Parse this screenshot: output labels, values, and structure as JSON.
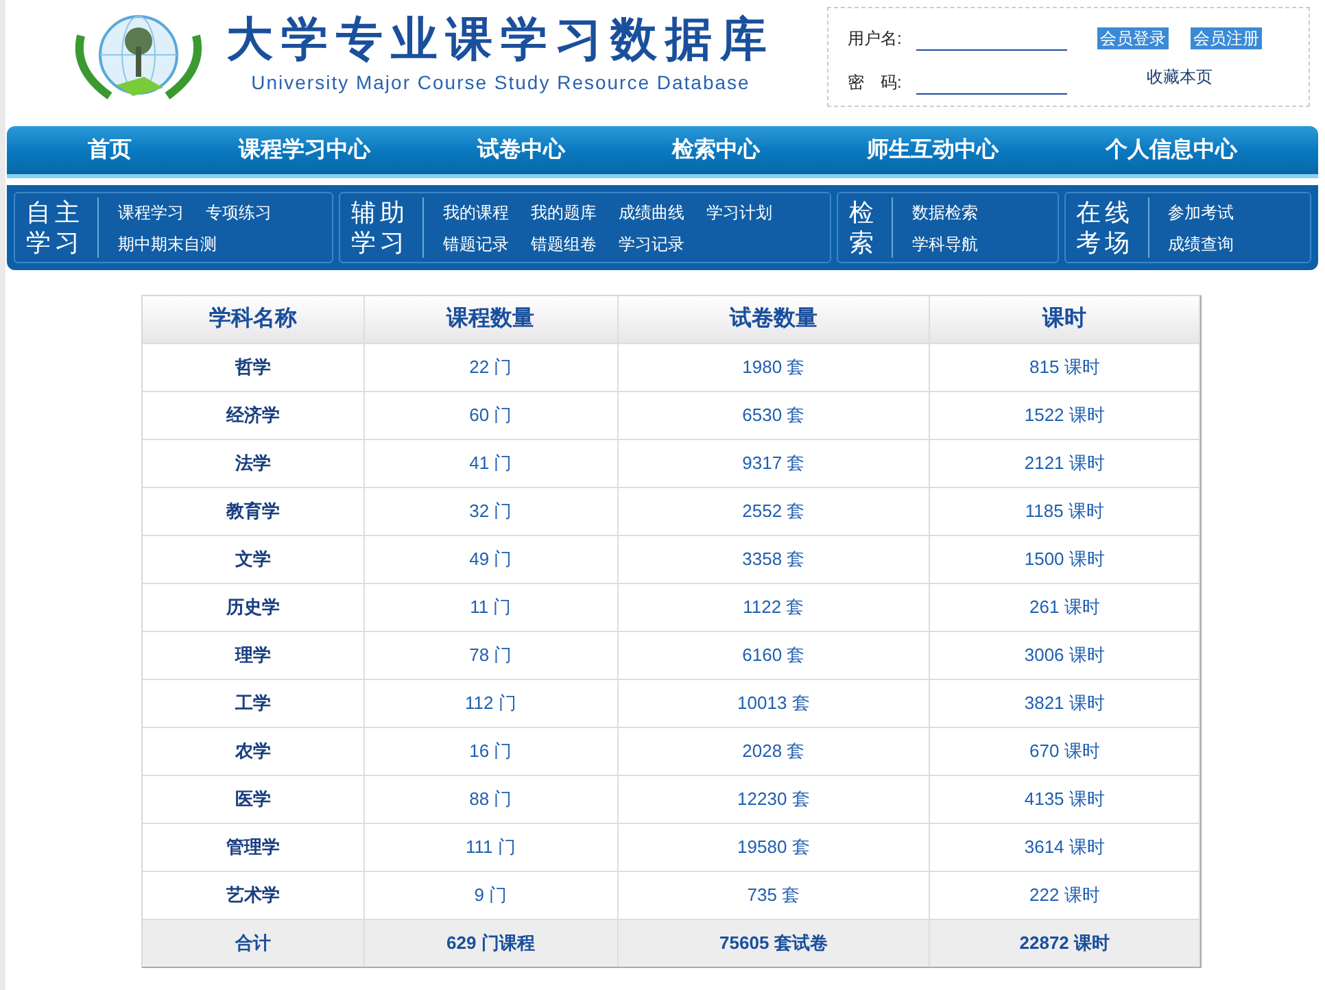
{
  "header": {
    "title": "大学专业课学习数据库",
    "subtitle": "University Major Course Study Resource Database"
  },
  "login": {
    "username_label": "用户名:",
    "password_label": "密　码:",
    "login_button": "会员登录",
    "register_button": "会员注册",
    "bookmark_link": "收藏本页"
  },
  "nav": [
    "首页",
    "课程学习中心",
    "试卷中心",
    "检索中心",
    "师生互动中心",
    "个人信息中心"
  ],
  "subnav": [
    {
      "title": [
        "自主",
        "学习"
      ],
      "links": [
        [
          "课程学习",
          "专项练习"
        ],
        [
          "期中期末自测"
        ]
      ]
    },
    {
      "title": [
        "辅助",
        "学习"
      ],
      "links": [
        [
          "我的课程",
          "我的题库",
          "成绩曲线",
          "学习计划"
        ],
        [
          "错题记录",
          "错题组卷",
          "学习记录"
        ]
      ]
    },
    {
      "title": [
        "检",
        "索"
      ],
      "links": [
        [
          "数据检索"
        ],
        [
          "学科导航"
        ]
      ]
    },
    {
      "title": [
        "在线",
        "考场"
      ],
      "links": [
        [
          "参加考试"
        ],
        [
          "成绩查询"
        ]
      ]
    }
  ],
  "table": {
    "columns": [
      "学科名称",
      "课程数量",
      "试卷数量",
      "课时"
    ],
    "rows": [
      [
        "哲学",
        "22 门",
        "1980 套",
        "815 课时"
      ],
      [
        "经济学",
        "60 门",
        "6530 套",
        "1522 课时"
      ],
      [
        "法学",
        "41 门",
        "9317 套",
        "2121 课时"
      ],
      [
        "教育学",
        "32 门",
        "2552 套",
        "1185 课时"
      ],
      [
        "文学",
        "49 门",
        "3358 套",
        "1500 课时"
      ],
      [
        "历史学",
        "11 门",
        "1122 套",
        "261 课时"
      ],
      [
        "理学",
        "78 门",
        "6160 套",
        "3006 课时"
      ],
      [
        "工学",
        "112 门",
        "10013 套",
        "3821 课时"
      ],
      [
        "农学",
        "16 门",
        "2028 套",
        "670 课时"
      ],
      [
        "医学",
        "88 门",
        "12230 套",
        "4135 课时"
      ],
      [
        "管理学",
        "111 门",
        "19580 套",
        "3614 课时"
      ],
      [
        "艺术学",
        "9 门",
        "735 套",
        "222 课时"
      ]
    ],
    "total": [
      "合计",
      "629 门课程",
      "75605 套试卷",
      "22872 课时"
    ]
  }
}
